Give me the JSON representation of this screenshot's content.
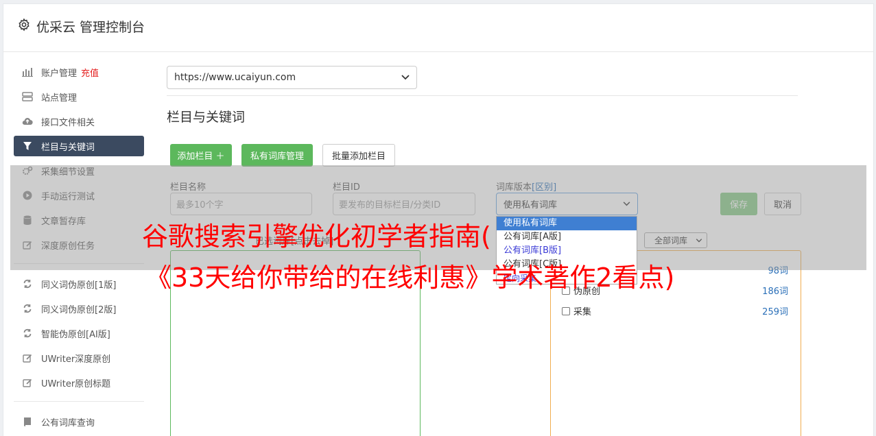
{
  "app": {
    "title": "优采云 管理控制台"
  },
  "sidebar": {
    "items": [
      {
        "label": "账户管理",
        "badge": "充值",
        "icon": "bar-chart-icon"
      },
      {
        "label": "站点管理",
        "icon": "server-icon"
      },
      {
        "label": "接口文件相关",
        "icon": "cloud-upload-icon"
      },
      {
        "label": "栏目与关键词",
        "icon": "filter-icon",
        "active": true
      },
      {
        "label": "采集细节设置",
        "icon": "cogs-icon"
      },
      {
        "label": "手动运行测试",
        "icon": "play-circle-icon"
      },
      {
        "label": "文章暂存库",
        "icon": "database-icon"
      },
      {
        "label": "深度原创任务",
        "icon": "edit-icon"
      }
    ],
    "items2": [
      {
        "label": "同义词伪原创[1版]",
        "icon": "refresh-icon"
      },
      {
        "label": "同义词伪原创[2版]",
        "icon": "refresh-icon"
      },
      {
        "label": "智能伪原创[AI版]",
        "icon": "refresh-icon"
      },
      {
        "label": "UWriter深度原创",
        "icon": "edit-icon"
      },
      {
        "label": "UWriter原创标题",
        "icon": "edit-icon"
      }
    ],
    "items3": [
      {
        "label": "公有词库查询",
        "icon": "book-icon"
      }
    ]
  },
  "main": {
    "site_select": "https://www.ucaiyun.com",
    "section_title": "栏目与关键词",
    "buttons": {
      "add_column": "添加栏目 ＋",
      "private_lib": "私有词库管理",
      "batch_add": "批量添加栏目",
      "save": "保存",
      "cancel": "取消"
    },
    "form": {
      "name_label": "栏目名称",
      "name_placeholder": "最多10个字",
      "id_label": "栏目ID",
      "id_placeholder": "要发布的目标栏目/分类ID",
      "version_label": "词库版本",
      "version_link": "[区别]",
      "version_value": "使用私有词库",
      "version_options": [
        "使用私有词库",
        "公有词库[A版]",
        "公有词库[B版]",
        "公有词库[C版]"
      ],
      "version_link_option": "定向采集"
    },
    "selected_hint": "已选词库[点击去掉]",
    "lib_filter": "全部词库",
    "libs": [
      {
        "label": "",
        "count": "98词"
      },
      {
        "label": "伪原创",
        "count": "186词"
      },
      {
        "label": "采集",
        "count": "259词"
      }
    ]
  },
  "watermark": {
    "line1": "谷歌搜索引擎优化初学者指南(",
    "line2": "《33天给你带给的在线利惠》学术著作2看点)"
  },
  "colors": {
    "accent_green": "#5cb85c",
    "nav_active": "#3b4a60",
    "red": "#ff0000",
    "link_blue": "#2a6fb8"
  }
}
